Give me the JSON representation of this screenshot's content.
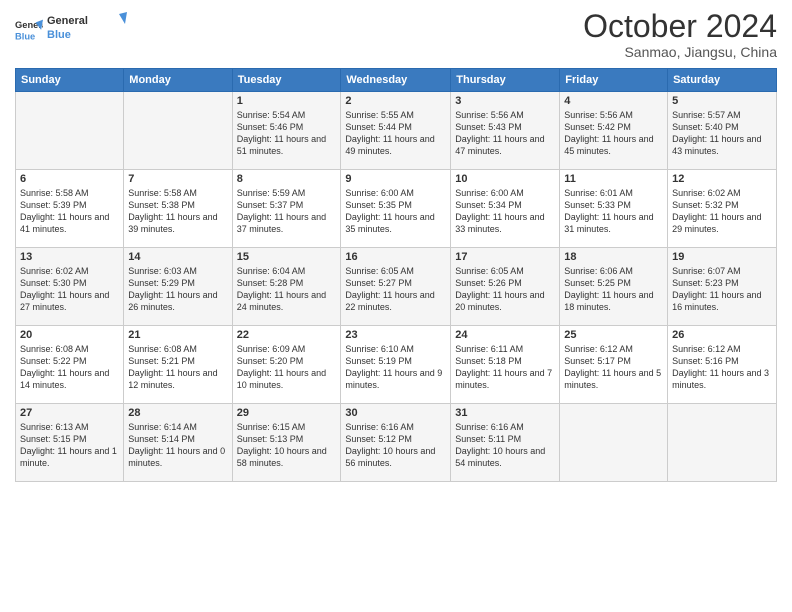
{
  "header": {
    "logo_general": "General",
    "logo_blue": "Blue",
    "month_title": "October 2024",
    "subtitle": "Sanmao, Jiangsu, China"
  },
  "days_of_week": [
    "Sunday",
    "Monday",
    "Tuesday",
    "Wednesday",
    "Thursday",
    "Friday",
    "Saturday"
  ],
  "weeks": [
    [
      {
        "day": "",
        "info": ""
      },
      {
        "day": "",
        "info": ""
      },
      {
        "day": "1",
        "info": "Sunrise: 5:54 AM\nSunset: 5:46 PM\nDaylight: 11 hours and 51 minutes."
      },
      {
        "day": "2",
        "info": "Sunrise: 5:55 AM\nSunset: 5:44 PM\nDaylight: 11 hours and 49 minutes."
      },
      {
        "day": "3",
        "info": "Sunrise: 5:56 AM\nSunset: 5:43 PM\nDaylight: 11 hours and 47 minutes."
      },
      {
        "day": "4",
        "info": "Sunrise: 5:56 AM\nSunset: 5:42 PM\nDaylight: 11 hours and 45 minutes."
      },
      {
        "day": "5",
        "info": "Sunrise: 5:57 AM\nSunset: 5:40 PM\nDaylight: 11 hours and 43 minutes."
      }
    ],
    [
      {
        "day": "6",
        "info": "Sunrise: 5:58 AM\nSunset: 5:39 PM\nDaylight: 11 hours and 41 minutes."
      },
      {
        "day": "7",
        "info": "Sunrise: 5:58 AM\nSunset: 5:38 PM\nDaylight: 11 hours and 39 minutes."
      },
      {
        "day": "8",
        "info": "Sunrise: 5:59 AM\nSunset: 5:37 PM\nDaylight: 11 hours and 37 minutes."
      },
      {
        "day": "9",
        "info": "Sunrise: 6:00 AM\nSunset: 5:35 PM\nDaylight: 11 hours and 35 minutes."
      },
      {
        "day": "10",
        "info": "Sunrise: 6:00 AM\nSunset: 5:34 PM\nDaylight: 11 hours and 33 minutes."
      },
      {
        "day": "11",
        "info": "Sunrise: 6:01 AM\nSunset: 5:33 PM\nDaylight: 11 hours and 31 minutes."
      },
      {
        "day": "12",
        "info": "Sunrise: 6:02 AM\nSunset: 5:32 PM\nDaylight: 11 hours and 29 minutes."
      }
    ],
    [
      {
        "day": "13",
        "info": "Sunrise: 6:02 AM\nSunset: 5:30 PM\nDaylight: 11 hours and 27 minutes."
      },
      {
        "day": "14",
        "info": "Sunrise: 6:03 AM\nSunset: 5:29 PM\nDaylight: 11 hours and 26 minutes."
      },
      {
        "day": "15",
        "info": "Sunrise: 6:04 AM\nSunset: 5:28 PM\nDaylight: 11 hours and 24 minutes."
      },
      {
        "day": "16",
        "info": "Sunrise: 6:05 AM\nSunset: 5:27 PM\nDaylight: 11 hours and 22 minutes."
      },
      {
        "day": "17",
        "info": "Sunrise: 6:05 AM\nSunset: 5:26 PM\nDaylight: 11 hours and 20 minutes."
      },
      {
        "day": "18",
        "info": "Sunrise: 6:06 AM\nSunset: 5:25 PM\nDaylight: 11 hours and 18 minutes."
      },
      {
        "day": "19",
        "info": "Sunrise: 6:07 AM\nSunset: 5:23 PM\nDaylight: 11 hours and 16 minutes."
      }
    ],
    [
      {
        "day": "20",
        "info": "Sunrise: 6:08 AM\nSunset: 5:22 PM\nDaylight: 11 hours and 14 minutes."
      },
      {
        "day": "21",
        "info": "Sunrise: 6:08 AM\nSunset: 5:21 PM\nDaylight: 11 hours and 12 minutes."
      },
      {
        "day": "22",
        "info": "Sunrise: 6:09 AM\nSunset: 5:20 PM\nDaylight: 11 hours and 10 minutes."
      },
      {
        "day": "23",
        "info": "Sunrise: 6:10 AM\nSunset: 5:19 PM\nDaylight: 11 hours and 9 minutes."
      },
      {
        "day": "24",
        "info": "Sunrise: 6:11 AM\nSunset: 5:18 PM\nDaylight: 11 hours and 7 minutes."
      },
      {
        "day": "25",
        "info": "Sunrise: 6:12 AM\nSunset: 5:17 PM\nDaylight: 11 hours and 5 minutes."
      },
      {
        "day": "26",
        "info": "Sunrise: 6:12 AM\nSunset: 5:16 PM\nDaylight: 11 hours and 3 minutes."
      }
    ],
    [
      {
        "day": "27",
        "info": "Sunrise: 6:13 AM\nSunset: 5:15 PM\nDaylight: 11 hours and 1 minute."
      },
      {
        "day": "28",
        "info": "Sunrise: 6:14 AM\nSunset: 5:14 PM\nDaylight: 11 hours and 0 minutes."
      },
      {
        "day": "29",
        "info": "Sunrise: 6:15 AM\nSunset: 5:13 PM\nDaylight: 10 hours and 58 minutes."
      },
      {
        "day": "30",
        "info": "Sunrise: 6:16 AM\nSunset: 5:12 PM\nDaylight: 10 hours and 56 minutes."
      },
      {
        "day": "31",
        "info": "Sunrise: 6:16 AM\nSunset: 5:11 PM\nDaylight: 10 hours and 54 minutes."
      },
      {
        "day": "",
        "info": ""
      },
      {
        "day": "",
        "info": ""
      }
    ]
  ]
}
